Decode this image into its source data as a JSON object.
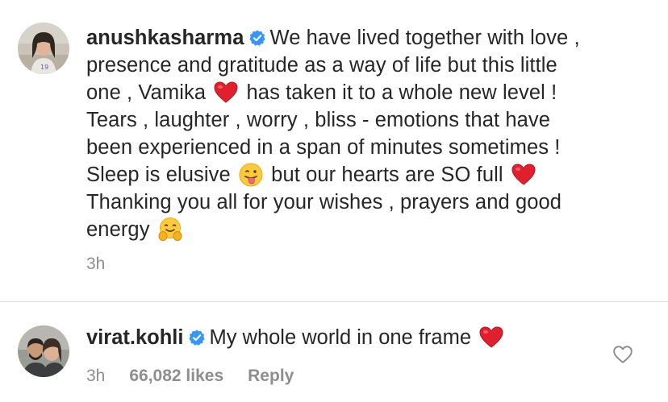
{
  "post": {
    "username": "anushkasharma",
    "verified": true,
    "caption_lines": [
      [
        "We have lived together with love ,"
      ],
      [
        "presence and gratitude as a way of life but this little"
      ],
      [
        "one , Vamika",
        "red-heart-emoji",
        "has taken it to a whole new level !"
      ],
      [
        "Tears , laughter , worry , bliss - emotions that have"
      ],
      [
        "been experienced in a span of minutes sometimes !"
      ],
      [
        "Sleep is elusive",
        "tongue-emoji",
        "but our hearts are SO full",
        "red-heart-emoji"
      ],
      [
        "Thanking you all for your wishes , prayers and good"
      ],
      [
        "energy",
        "hugging-emoji"
      ]
    ],
    "time": "3h"
  },
  "comment": {
    "username": "virat.kohli",
    "verified": true,
    "text": "My whole world in one frame",
    "emoji": "red-heart-emoji",
    "time": "3h",
    "likes": "66,082 likes",
    "reply_label": "Reply",
    "like_icon": "heart-outline-icon"
  },
  "colors": {
    "text": "#262626",
    "secondary": "#8e8e8e",
    "verified": "#3897f0",
    "divider": "#dbdbdb"
  }
}
